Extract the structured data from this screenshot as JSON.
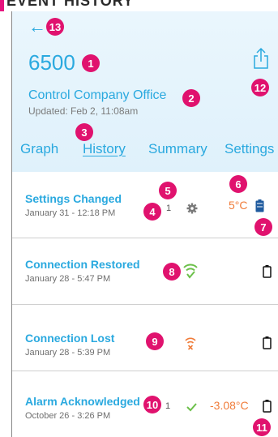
{
  "screen_title": "EVENT HISTORY",
  "device": {
    "id": "6500",
    "location": "Control Company Office",
    "updated": "Updated: Feb 2, 11:08am"
  },
  "tabs": [
    {
      "label": "Graph"
    },
    {
      "label": "History"
    },
    {
      "label": "Summary"
    },
    {
      "label": "Settings"
    }
  ],
  "active_tab": "History",
  "events": [
    {
      "title": "Settings Changed",
      "date": "January 31 - 12:18 PM",
      "count": "1",
      "icon": "gear-icon",
      "temp": "5°C",
      "battery": "battery-icon-full"
    },
    {
      "title": "Connection Restored",
      "date": "January 28 - 5:47 PM",
      "icon": "wifi-check-icon",
      "battery": "battery-icon-empty"
    },
    {
      "title": "Connection Lost",
      "date": "January 28 - 5:39 PM",
      "icon": "wifi-x-icon",
      "battery": "battery-icon-empty"
    },
    {
      "title": "Alarm Acknowledged",
      "date": "October 26 - 3:26 PM",
      "count": "1",
      "icon": "check-icon",
      "temp": "-3.08°C",
      "battery": "battery-icon-empty"
    }
  ],
  "annotations": [
    "1",
    "2",
    "3",
    "4",
    "5",
    "6",
    "7",
    "8",
    "9",
    "10",
    "11",
    "12",
    "13"
  ],
  "colors": {
    "accent": "#2aa9df",
    "annotation": "#e0126e",
    "warning": "#f07c3a",
    "success": "#6cc04a",
    "header_bg": "#e6f4fc"
  },
  "icons": {
    "back": "back-arrow-icon",
    "share": "share-icon"
  }
}
